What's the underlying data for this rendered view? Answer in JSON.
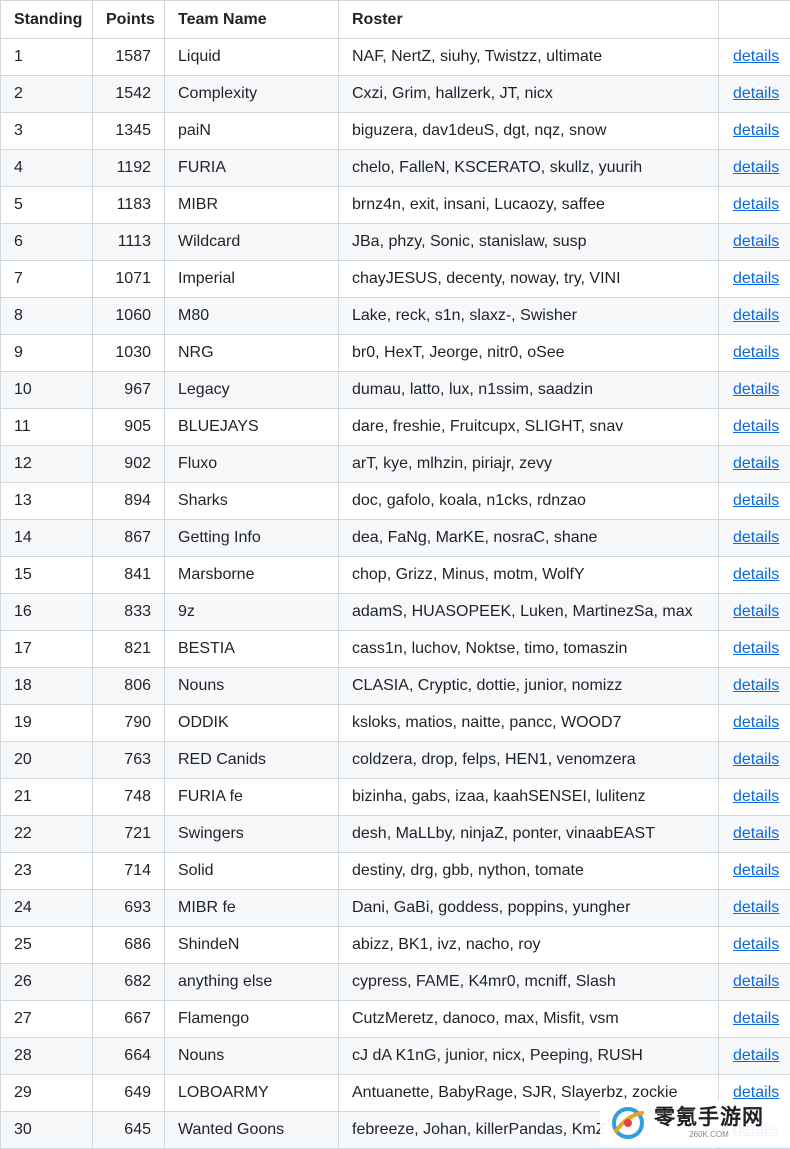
{
  "table": {
    "headers": [
      "Standing",
      "Points",
      "Team Name",
      "Roster",
      ""
    ],
    "link_label": "details",
    "rows": [
      [
        "1",
        "1587",
        "Liquid",
        "NAF, NertZ, siuhy, Twistzz, ultimate"
      ],
      [
        "2",
        "1542",
        "Complexity",
        "Cxzi, Grim, hallzerk, JT, nicx"
      ],
      [
        "3",
        "1345",
        "paiN",
        "biguzera, dav1deuS, dgt, nqz, snow"
      ],
      [
        "4",
        "1192",
        "FURIA",
        "chelo, FalleN, KSCERATO, skullz, yuurih"
      ],
      [
        "5",
        "1183",
        "MIBR",
        "brnz4n, exit, insani, Lucaozy, saffee"
      ],
      [
        "6",
        "1113",
        "Wildcard",
        "JBa, phzy, Sonic, stanislaw, susp"
      ],
      [
        "7",
        "1071",
        "Imperial",
        "chayJESUS, decenty, noway, try, VINI"
      ],
      [
        "8",
        "1060",
        "M80",
        "Lake, reck, s1n, slaxz-, Swisher"
      ],
      [
        "9",
        "1030",
        "NRG",
        "br0, HexT, Jeorge, nitr0, oSee"
      ],
      [
        "10",
        "967",
        "Legacy",
        "dumau, latto, lux, n1ssim, saadzin"
      ],
      [
        "11",
        "905",
        "BLUEJAYS",
        "dare, freshie, Fruitcupx, SLIGHT, snav"
      ],
      [
        "12",
        "902",
        "Fluxo",
        "arT, kye, mlhzin, piriajr, zevy"
      ],
      [
        "13",
        "894",
        "Sharks",
        "doc, gafolo, koala, n1cks, rdnzao"
      ],
      [
        "14",
        "867",
        "Getting Info",
        "dea, FaNg, MarKE, nosraC, shane"
      ],
      [
        "15",
        "841",
        "Marsborne",
        "chop, Grizz, Minus, motm, WolfY"
      ],
      [
        "16",
        "833",
        "9z",
        "adamS, HUASOPEEK, Luken, MartinezSa, max"
      ],
      [
        "17",
        "821",
        "BESTIA",
        "cass1n, luchov, Noktse, timo, tomaszin"
      ],
      [
        "18",
        "806",
        "Nouns",
        "CLASIA, Cryptic, dottie, junior, nomizz"
      ],
      [
        "19",
        "790",
        "ODDIK",
        "ksloks, matios, naitte, pancc, WOOD7"
      ],
      [
        "20",
        "763",
        "RED Canids",
        "coldzera, drop, felps, HEN1, venomzera"
      ],
      [
        "21",
        "748",
        "FURIA fe",
        "bizinha, gabs, izaa, kaahSENSEI, lulitenz"
      ],
      [
        "22",
        "721",
        "Swingers",
        "desh, MaLLby, ninjaZ, ponter, vinaabEAST"
      ],
      [
        "23",
        "714",
        "Solid",
        "destiny, drg, gbb, nython, tomate"
      ],
      [
        "24",
        "693",
        "MIBR fe",
        "Dani, GaBi, goddess, poppins, yungher"
      ],
      [
        "25",
        "686",
        "ShindeN",
        "abizz, BK1, ivz, nacho, roy"
      ],
      [
        "26",
        "682",
        "anything else",
        "cypress, FAME, K4mr0, mcniff, Slash"
      ],
      [
        "27",
        "667",
        "Flamengo",
        "CutzMeretz, danoco, max, Misfit, vsm"
      ],
      [
        "28",
        "664",
        "Nouns",
        "cJ dA K1nG, junior, nicx, Peeping, RUSH"
      ],
      [
        "29",
        "649",
        "LOBOARMY",
        "Antuanette, BabyRage, SJR, Slayerbz, zockie"
      ],
      [
        "30",
        "645",
        "Wanted Goons",
        "febreeze, Johan, killerPandas, KmZ"
      ]
    ]
  },
  "watermark": {
    "title": "零氪手游网",
    "sub": "260K.COM"
  }
}
